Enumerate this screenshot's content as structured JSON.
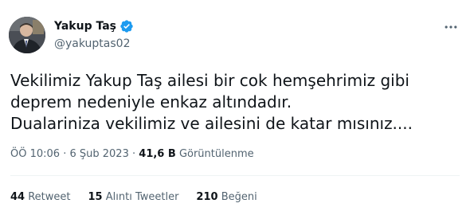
{
  "author": {
    "name": "Yakup Taş",
    "handle": "@yakuptas02",
    "verified_badge": "verified-badge-icon"
  },
  "tweet": {
    "text": "Vekilimiz Yakup Taş ailesi bir cok hemşehrimiz gibi\ndeprem nedeniyle enkaz altındadır.\nDualariniza vekilimiz ve ailesini de katar mısınız....",
    "time": "ÖÖ 10:06",
    "separator": "·",
    "date": "6 Şub 2023",
    "views_count": "41,6 B",
    "views_label": "Görüntülenme"
  },
  "stats": {
    "retweets_count": "44",
    "retweets_label": "Retweet",
    "quotes_count": "15",
    "quotes_label": "Alıntı Tweetler",
    "likes_count": "210",
    "likes_label": "Beğeni"
  },
  "colors": {
    "text_primary": "#0f1419",
    "text_secondary": "#536471",
    "verified": "#1d9bf0",
    "divider": "#eff3f4"
  },
  "icons": {
    "more": "more-horizontal-icon"
  }
}
